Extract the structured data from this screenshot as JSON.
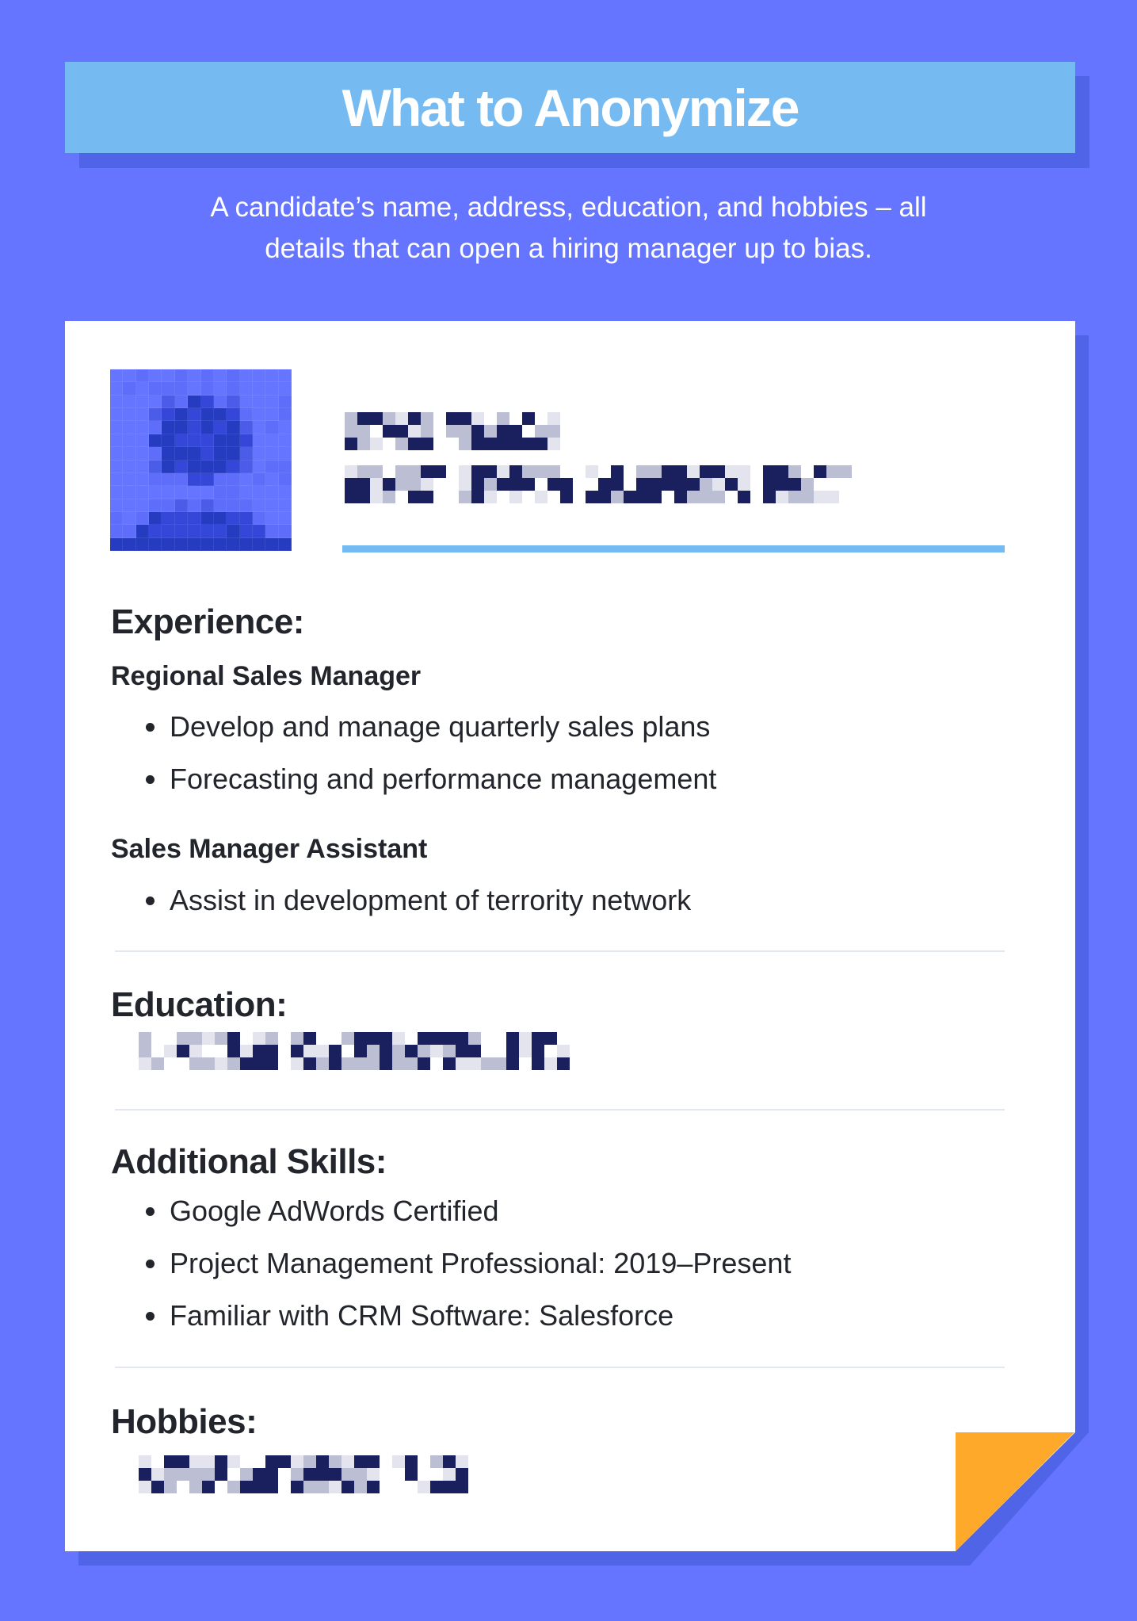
{
  "header": {
    "title": "What to Anonymize",
    "subtitle_line1": "A candidate’s name, address, education, and hobbies – all",
    "subtitle_line2": "details that can open a hiring manager up to bias."
  },
  "colors": {
    "background": "#6675FF",
    "shadow": "#5064E8",
    "banner": "#75BBF2",
    "accent_fold": "#FFA92A",
    "pixel_dark": "#1A1F5E",
    "pixel_mid": "#BCBFD4",
    "pixel_light": "#E3E4EE"
  },
  "resume": {
    "avatar_icon": "pixelated-person-icon",
    "name_redacted": true,
    "experience": {
      "heading": "Experience:",
      "jobs": [
        {
          "title": "Regional Sales Manager",
          "bullets": [
            "Develop and manage quarterly sales plans",
            "Forecasting and performance management"
          ]
        },
        {
          "title": "Sales Manager Assistant",
          "bullets": [
            "Assist in development of terrority network"
          ]
        }
      ]
    },
    "education": {
      "heading": "Education:",
      "redacted": true
    },
    "skills": {
      "heading": "Additional Skills:",
      "bullets": [
        "Google AdWords Certified",
        "Project Management Professional: 2019–Present",
        "Familiar with CRM Software: Salesforce"
      ]
    },
    "hobbies": {
      "heading": "Hobbies:",
      "redacted": true
    }
  }
}
